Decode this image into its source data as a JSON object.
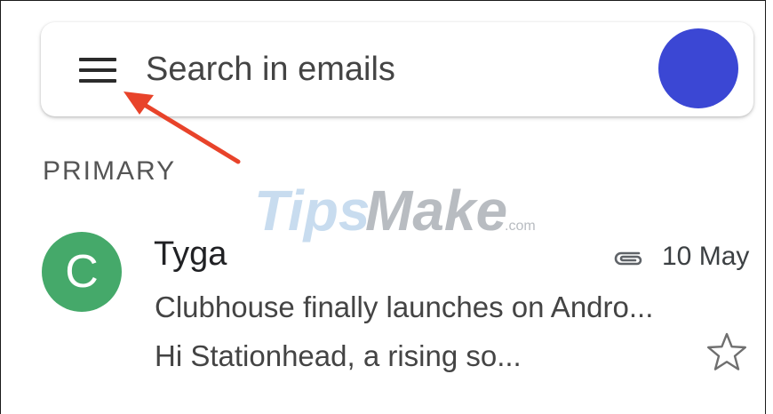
{
  "search": {
    "placeholder": "Search in emails"
  },
  "section": {
    "label": "PRIMARY"
  },
  "watermark": {
    "text_main": "TipsMake",
    "text_suffix": ".com"
  },
  "email": {
    "avatar_letter": "C",
    "sender": "Tyga",
    "date": "10 May",
    "subject": "Clubhouse finally launches on Andro...",
    "snippet": "Hi Stationhead, a rising so...",
    "has_attachment": true,
    "starred": false
  },
  "icons": {
    "menu": "menu-icon",
    "attachment": "paperclip-icon",
    "star": "star-outline-icon"
  },
  "colors": {
    "account_avatar": "#3b47d4",
    "sender_avatar": "#45a96a",
    "annotation_arrow": "#e8432a"
  }
}
